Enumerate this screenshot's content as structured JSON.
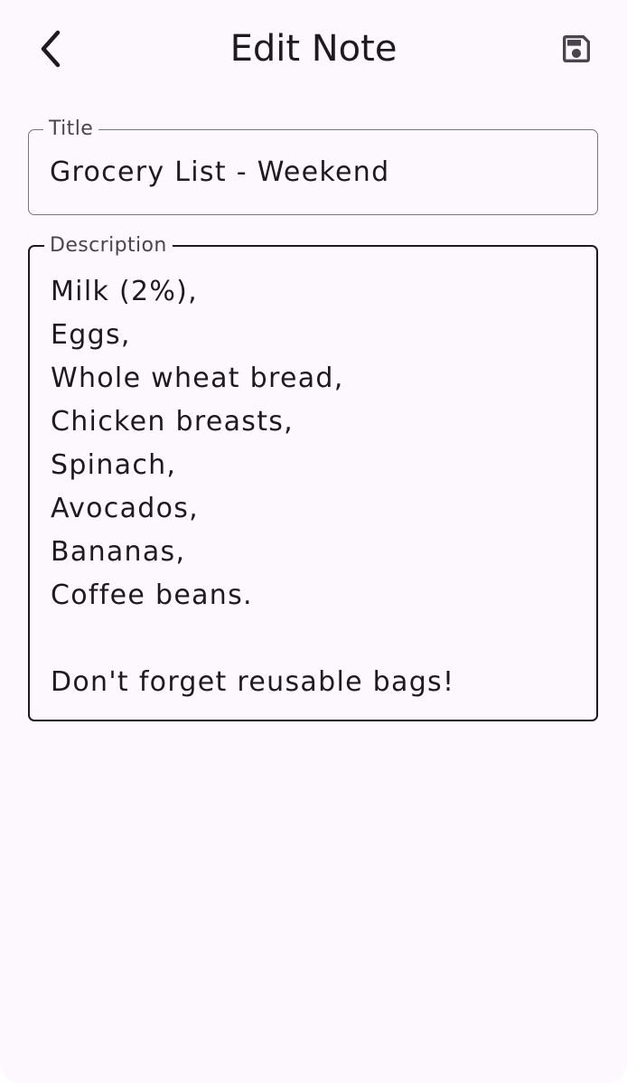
{
  "header": {
    "title": "Edit Note",
    "back_icon": "chevron-left-icon",
    "save_icon": "save-icon"
  },
  "form": {
    "title_label": "Title",
    "title_value": "Grocery List - Weekend",
    "description_label": "Description",
    "description_value": "Milk (2%),\nEggs,\nWhole wheat bread,\nChicken breasts,\nSpinach,\nAvocados,\nBananas,\nCoffee beans.\n\nDon't forget reusable bags!"
  },
  "colors": {
    "background": "#fdf8fd",
    "text": "#1d1b20",
    "label": "#49454f",
    "outline": "#79747e",
    "outline_focused": "#1d1b20"
  }
}
